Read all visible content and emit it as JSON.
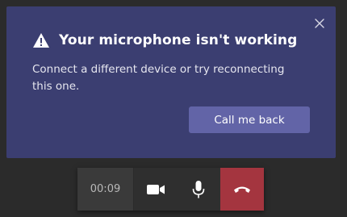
{
  "notification": {
    "title": "Your microphone isn't working",
    "message": "Connect a different device or try reconnecting this one.",
    "callback_button": "Call me back",
    "icons": {
      "warning": "warning-icon",
      "close": "close-icon"
    }
  },
  "call_controls": {
    "timer": "00:09",
    "icons": {
      "video": "video-camera-icon",
      "mic": "microphone-icon",
      "hangup": "hang-up-phone-icon"
    }
  },
  "colors": {
    "toast_bg": "#3b3e71",
    "accent": "#6264a7",
    "hangup": "#a4353f",
    "background": "#2b2b2b"
  }
}
